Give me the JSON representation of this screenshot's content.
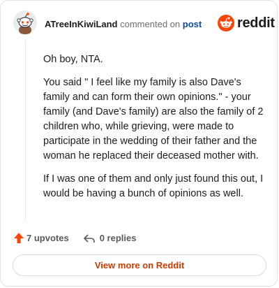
{
  "header": {
    "username": "ATreeInKiwiLand",
    "commented_text": "commented on",
    "post_link": "post",
    "logo_text": "reddit"
  },
  "comment": {
    "paragraphs": [
      "Oh boy, NTA.",
      "You said \" I feel like my family is also Dave's family and can form their own opinions.\" - your family (and Dave's family) are also the family of 2 children who, while grieving, were made to participate in the wedding of their father and the woman he replaced their deceased mother with.",
      "If I was one of them and only just found this out, I would be having a bunch of opinions as well."
    ]
  },
  "footer": {
    "upvotes_label": "7 upvotes",
    "replies_label": "0 replies"
  },
  "view_more_label": "View more on Reddit",
  "colors": {
    "reddit_orange": "#ff4500",
    "link_blue": "#0a4b9b",
    "view_more_text": "#cc3b00"
  },
  "icons": {
    "avatar": "snoo-avatar-icon",
    "logo": "reddit-logo-icon",
    "upvote": "upvote-arrow-icon",
    "reply": "reply-arrow-icon"
  }
}
